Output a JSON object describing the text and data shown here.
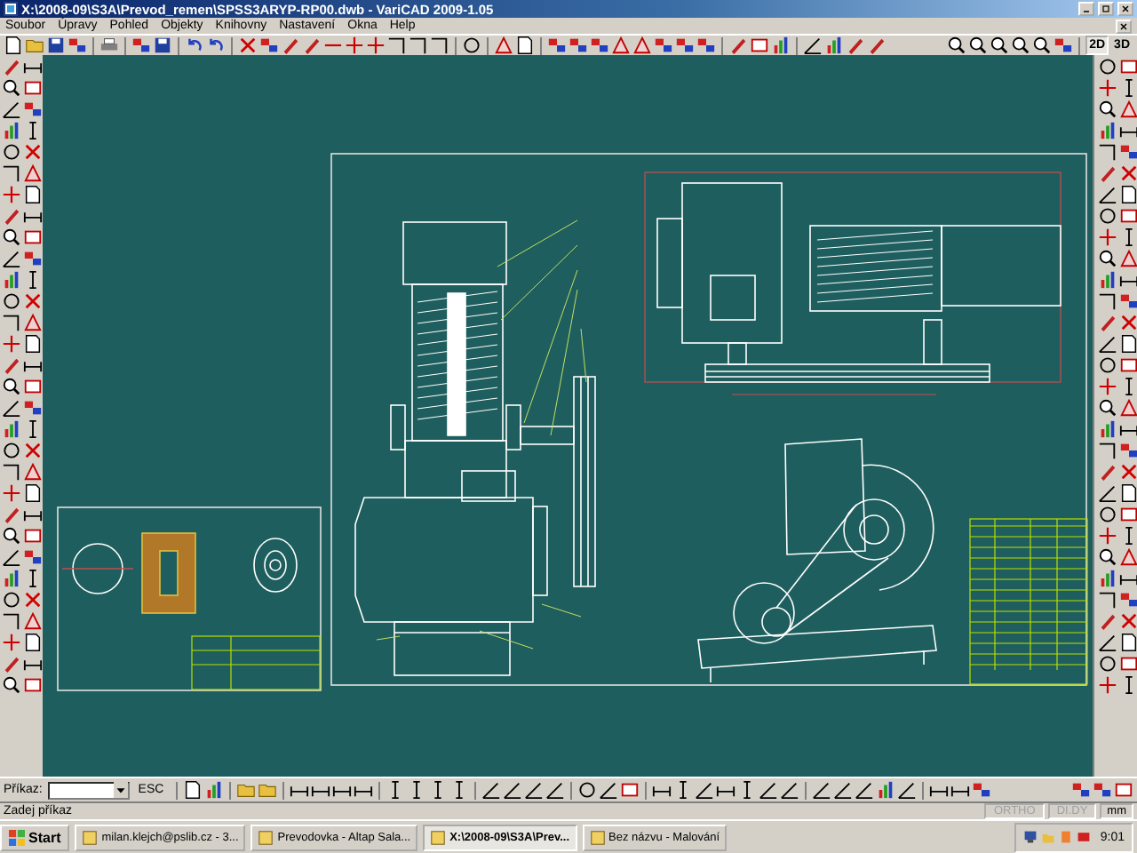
{
  "window": {
    "title": "X:\\2008-09\\S3A\\Prevod_remen\\SPSS3ARYP-RP00.dwb - VariCAD 2009-1.05"
  },
  "menu": [
    "Soubor",
    "Úpravy",
    "Pohled",
    "Objekty",
    "Knihovny",
    "Nastavení",
    "Okna",
    "Help"
  ],
  "view_buttons": [
    {
      "label": "2D",
      "selected": true
    },
    {
      "label": "3D",
      "selected": false
    }
  ],
  "command_bar": {
    "label": "Příkaz:",
    "esc_button": "ESC"
  },
  "status_bar": {
    "prompt": "Zadej příkaz",
    "toggles": [
      {
        "label": "ORTHO",
        "on": false
      },
      {
        "label": "DI.DY",
        "on": false
      }
    ],
    "units": "mm"
  },
  "taskbar": {
    "start": "Start",
    "tasks": [
      {
        "label": "milan.klejch@pslib.cz - 3...",
        "selected": false
      },
      {
        "label": "Prevodovka - Altap Sala...",
        "selected": false
      },
      {
        "label": "X:\\2008-09\\S3A\\Prev...",
        "selected": true
      },
      {
        "label": "Bez názvu - Malování",
        "selected": false
      }
    ],
    "clock": "9:01"
  }
}
